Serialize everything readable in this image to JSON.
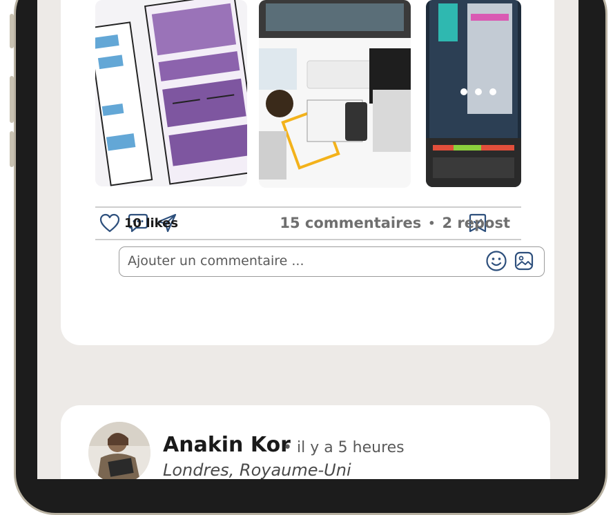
{
  "post": {
    "likes": "10 likes",
    "comments": "15 commentaires",
    "separator": "•",
    "reposts": "2 repost",
    "comment_placeholder": "Ajouter un commentaire ..."
  },
  "next_post": {
    "author": "Anakin Kor",
    "time": "• il y a 5 heures",
    "location": "Londres, Royaume-Uni"
  },
  "icons": {
    "like": "heart-icon",
    "comment": "comment-bubble-icon",
    "share": "paper-plane-icon",
    "save": "bookmark-icon",
    "emoji": "smiley-icon",
    "attach_image": "image-icon"
  },
  "colors": {
    "screen_bg": "#edeae7",
    "card_bg": "#ffffff",
    "icon_blue": "#2d4f7c",
    "stats_gray": "#6f6f6f"
  }
}
